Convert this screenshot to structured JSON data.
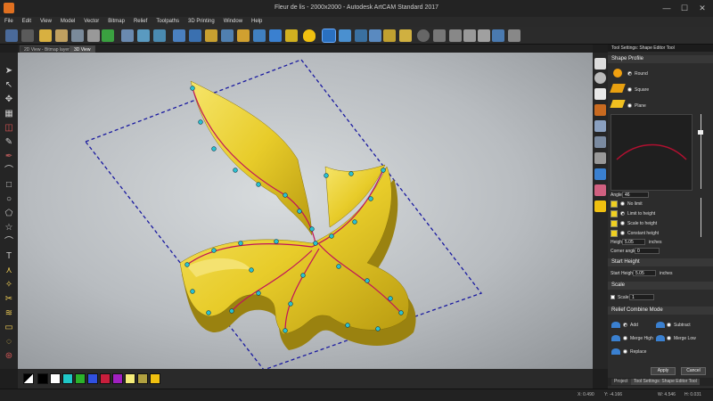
{
  "window": {
    "title": "Fleur de lis - 2000x2000 - Autodesk ArtCAM Standard 2017",
    "minimize": "—",
    "maximize": "☐",
    "close": "✕"
  },
  "menu": [
    "File",
    "Edit",
    "View",
    "Model",
    "Vector",
    "Bitmap",
    "Relief",
    "Toolpaths",
    "3D Printing",
    "Window",
    "Help"
  ],
  "view_tabs": [
    "2D View - Bitmap layer",
    "3D View"
  ],
  "panel": {
    "title": "Tool Settings: Shape Editor Tool",
    "shape_profile": {
      "heading": "Shape Profile",
      "options": [
        "Round",
        "Square",
        "Plane"
      ],
      "selected": "Round"
    },
    "angle": {
      "label": "Angle",
      "value": "46"
    },
    "height_modes": {
      "options": [
        "No limit",
        "Limit to height",
        "Scale to height",
        "Constant height"
      ],
      "selected": "Limit to height"
    },
    "height": {
      "label": "Height",
      "value": "5.05",
      "unit": "inches"
    },
    "corner_angle": {
      "label": "Corner angle:",
      "value": "0"
    },
    "start_height": {
      "heading": "Start Height",
      "label": "Start Height",
      "value": "5.05",
      "unit": "inches"
    },
    "scale": {
      "heading": "Scale",
      "label": "Scale",
      "value": "1"
    },
    "combine": {
      "heading": "Relief Combine Mode",
      "options": [
        "Add",
        "Subtract",
        "Merge High",
        "Merge Low",
        "Replace"
      ],
      "selected": "Add"
    },
    "apply_label": "Apply",
    "cancel_label": "Cancel",
    "bottom_tabs": [
      "Project",
      "Tool Settings: Shape Editor Tool"
    ]
  },
  "palette": [
    "#000000",
    "#ffffff",
    "#20c8c8",
    "#2bb32b",
    "#3050e0",
    "#c81e3c",
    "#a020c0",
    "#f4ec7a",
    "#b0a040",
    "#f0c010"
  ],
  "status": {
    "x": "X: 0.490",
    "y": "Y: -4.166",
    "xd": "W: 4.546",
    "h": "H: 0.031"
  }
}
